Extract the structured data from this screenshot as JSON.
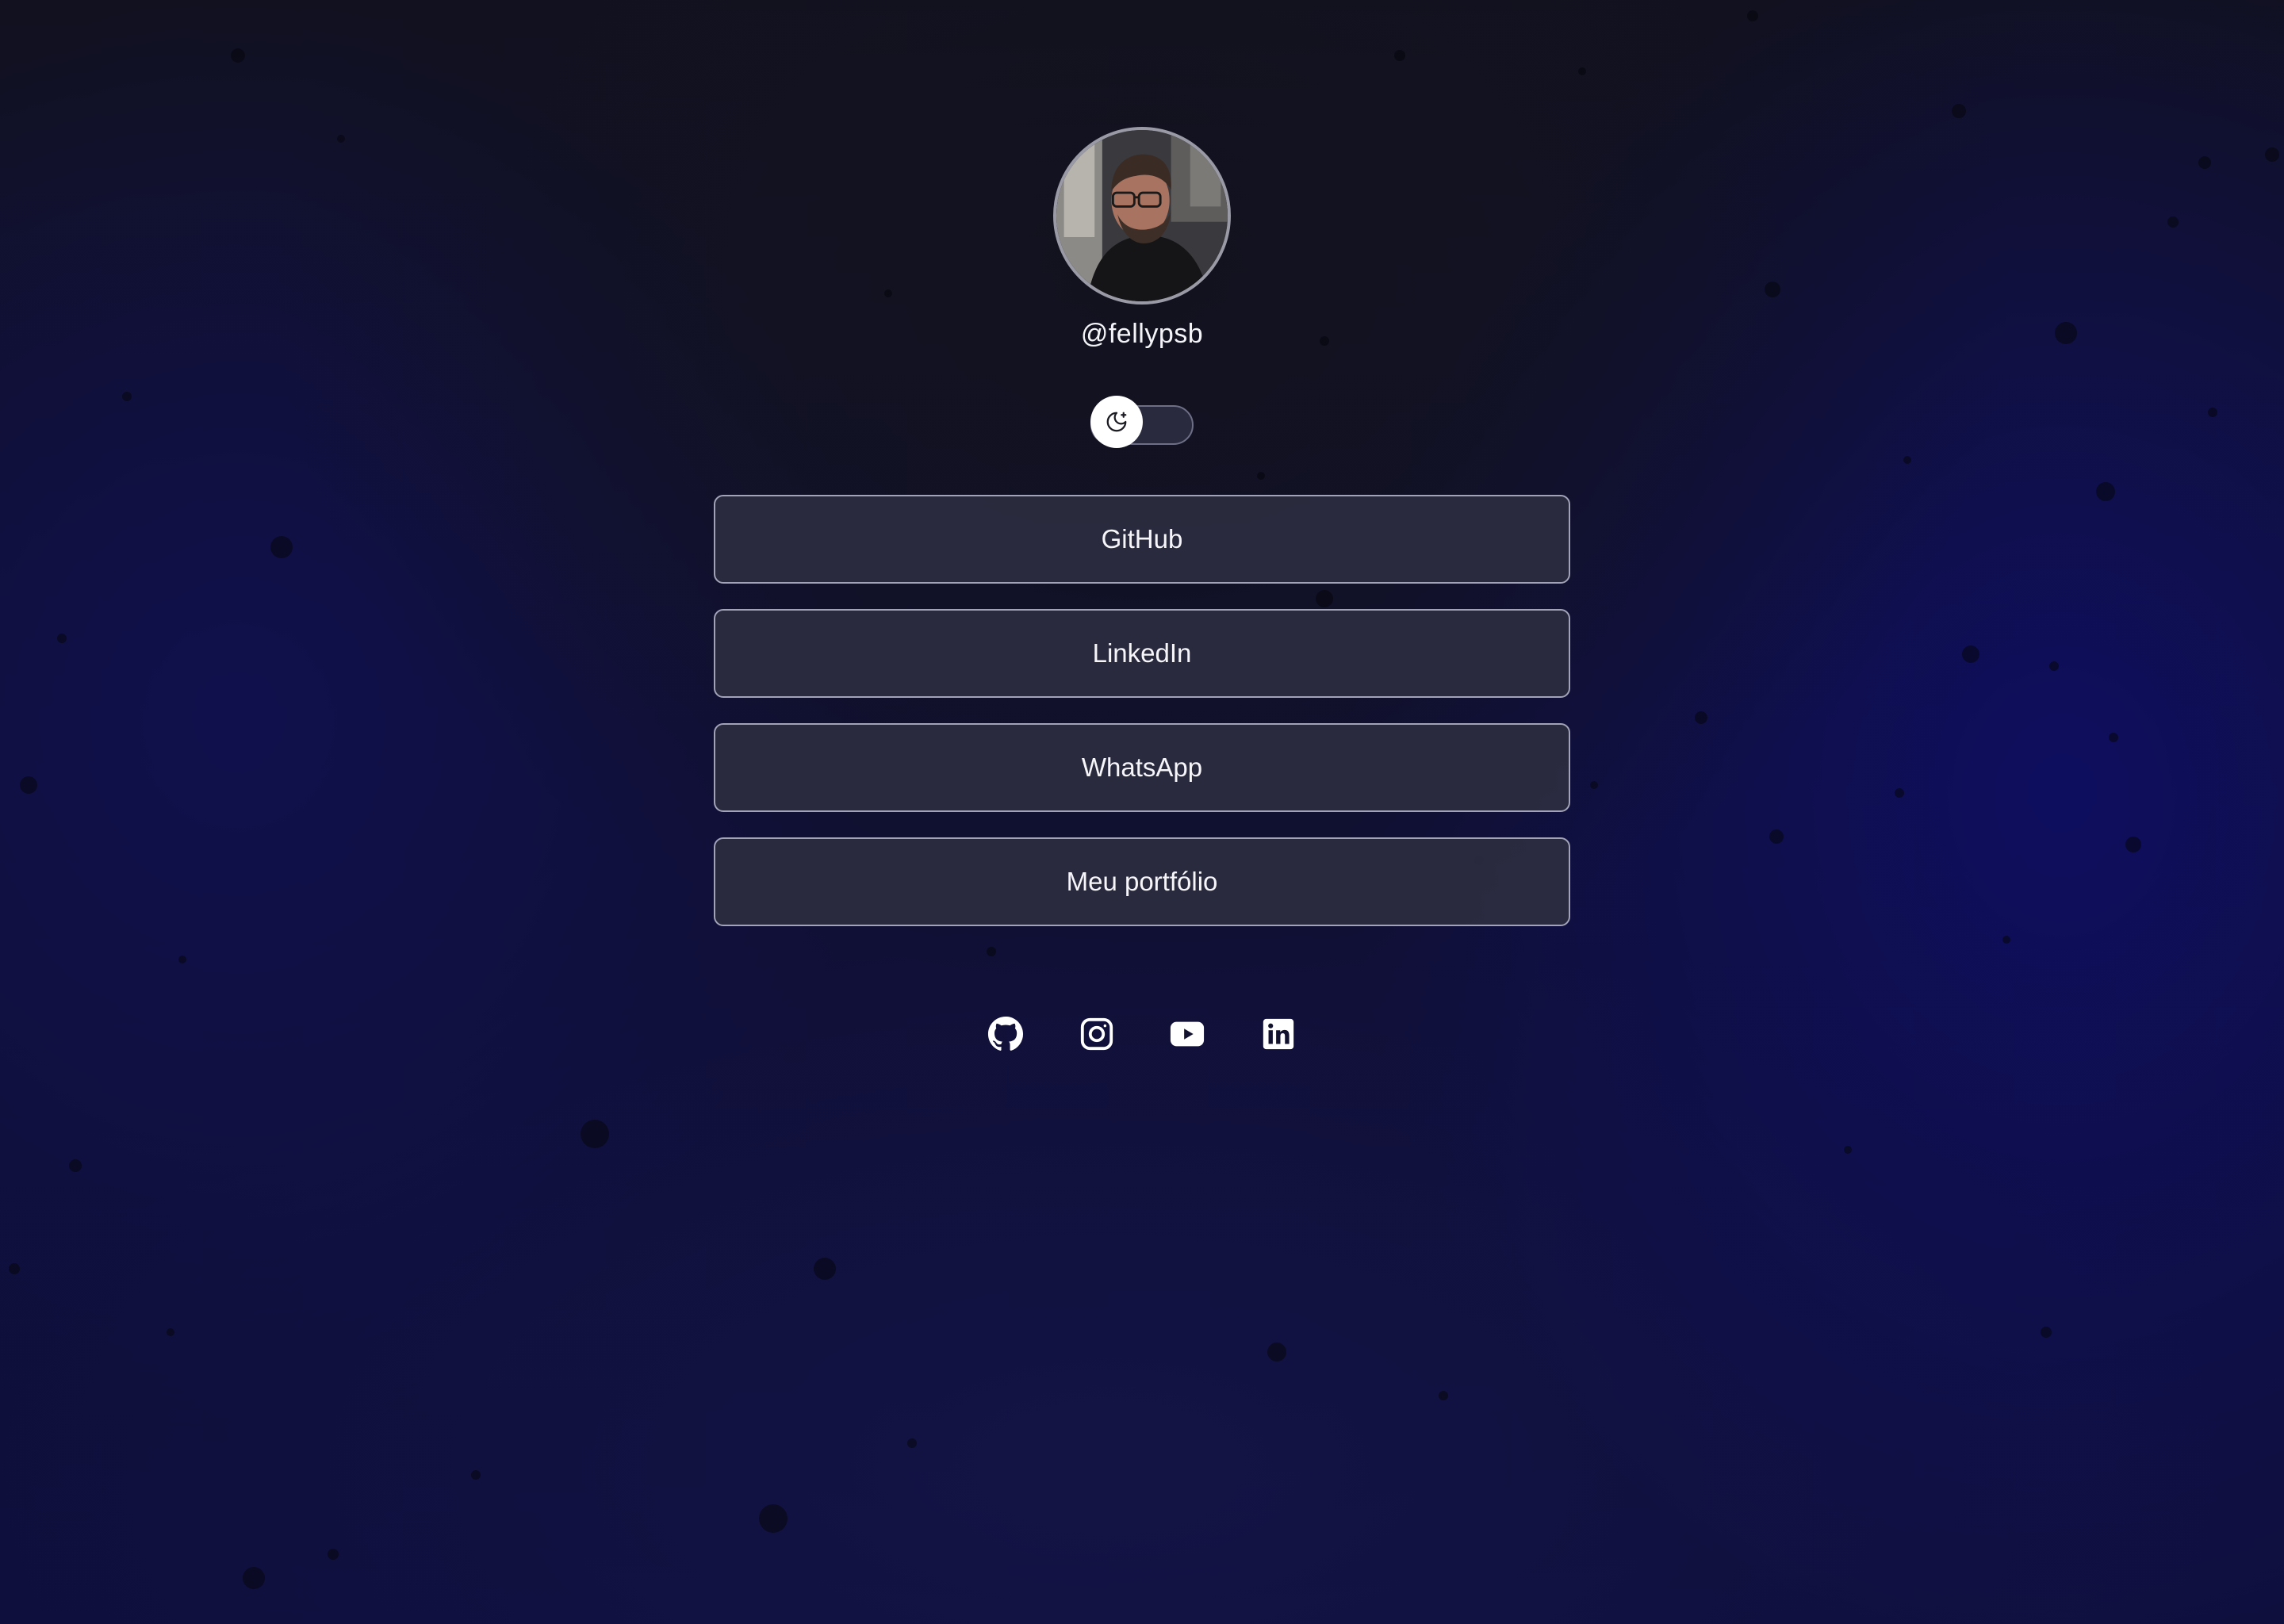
{
  "profile": {
    "handle": "@fellypsb"
  },
  "theme_toggle": {
    "state": "dark",
    "icon": "moon-icon"
  },
  "links": [
    {
      "label": "GitHub"
    },
    {
      "label": "LinkedIn"
    },
    {
      "label": "WhatsApp"
    },
    {
      "label": "Meu portfólio"
    }
  ],
  "socials": [
    {
      "icon": "github-icon"
    },
    {
      "icon": "instagram-icon"
    },
    {
      "icon": "youtube-icon"
    },
    {
      "icon": "linkedin-icon"
    }
  ],
  "colors": {
    "background_top": "#111120",
    "background_bottom": "#0f0f3e",
    "button_fill": "#2c2c40",
    "button_border": "#a2a2b8",
    "text": "#ffffff"
  }
}
